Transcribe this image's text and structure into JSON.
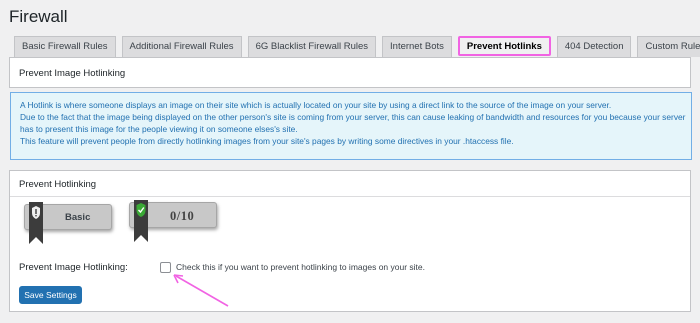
{
  "page": {
    "title": "Firewall"
  },
  "tabs": [
    {
      "label": "Basic Firewall Rules",
      "active": false
    },
    {
      "label": "Additional Firewall Rules",
      "active": false
    },
    {
      "label": "6G Blacklist Firewall Rules",
      "active": false
    },
    {
      "label": "Internet Bots",
      "active": false
    },
    {
      "label": "Prevent Hotlinks",
      "active": true
    },
    {
      "label": "404 Detection",
      "active": false
    },
    {
      "label": "Custom Rules",
      "active": false
    }
  ],
  "section": {
    "title": "Prevent Image Hotlinking"
  },
  "info": {
    "lines": [
      "A Hotlink is where someone displays an image on their site which is actually located on your site by using a direct link to the source of the image on your server.",
      "Due to the fact that the image being displayed on the other person's site is coming from your server, this can cause leaking of bandwidth and resources for you because your server",
      "has to present this image for the people viewing it on someone elses's site.",
      "This feature will prevent people from directly hotlinking images from your site's pages by writing some directives in your .htaccess file."
    ]
  },
  "postbox": {
    "title": "Prevent Hotlinking",
    "badge_basic": "Basic",
    "badge_score": "0/10",
    "field_label": "Prevent Image Hotlinking:",
    "checkbox_label": "Check this if you want to prevent hotlinking to images on your site.",
    "checkbox_checked": false,
    "save_label": "Save Settings"
  },
  "colors": {
    "active_tab_border": "#f163e3",
    "info_text": "#2271b1",
    "primary_button": "#2271b1",
    "annotation_arrow": "#f163e3",
    "shield_green": "#3aa935"
  }
}
